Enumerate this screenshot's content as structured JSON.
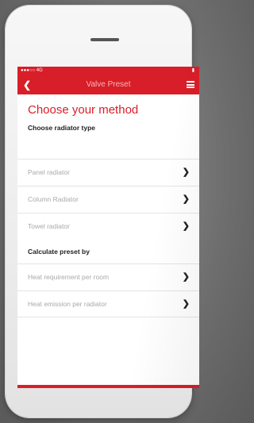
{
  "status_bar": {
    "carrier": "●●●○○ 4G",
    "battery": "▮"
  },
  "nav": {
    "title": "Valve Preset"
  },
  "page_title": "Choose your method",
  "radiator_section": {
    "label": "Choose radiator type",
    "items": [
      {
        "label": "Panel radiator",
        "icon": "chevron-right-icon"
      },
      {
        "label": "Column Radiator",
        "icon": "chevron-right-icon"
      },
      {
        "label": "Towel radiator",
        "icon": "chevron-right-icon"
      }
    ]
  },
  "preset_section": {
    "label": "Calculate preset by",
    "items": [
      {
        "label": "Heat requirement per room",
        "icon": "chevron-right-icon"
      },
      {
        "label": "Heat emission per radiator",
        "icon": "chevron-right-icon"
      }
    ]
  },
  "colors": {
    "accent": "#d81e28",
    "muted_text": "#a9a9a9"
  }
}
